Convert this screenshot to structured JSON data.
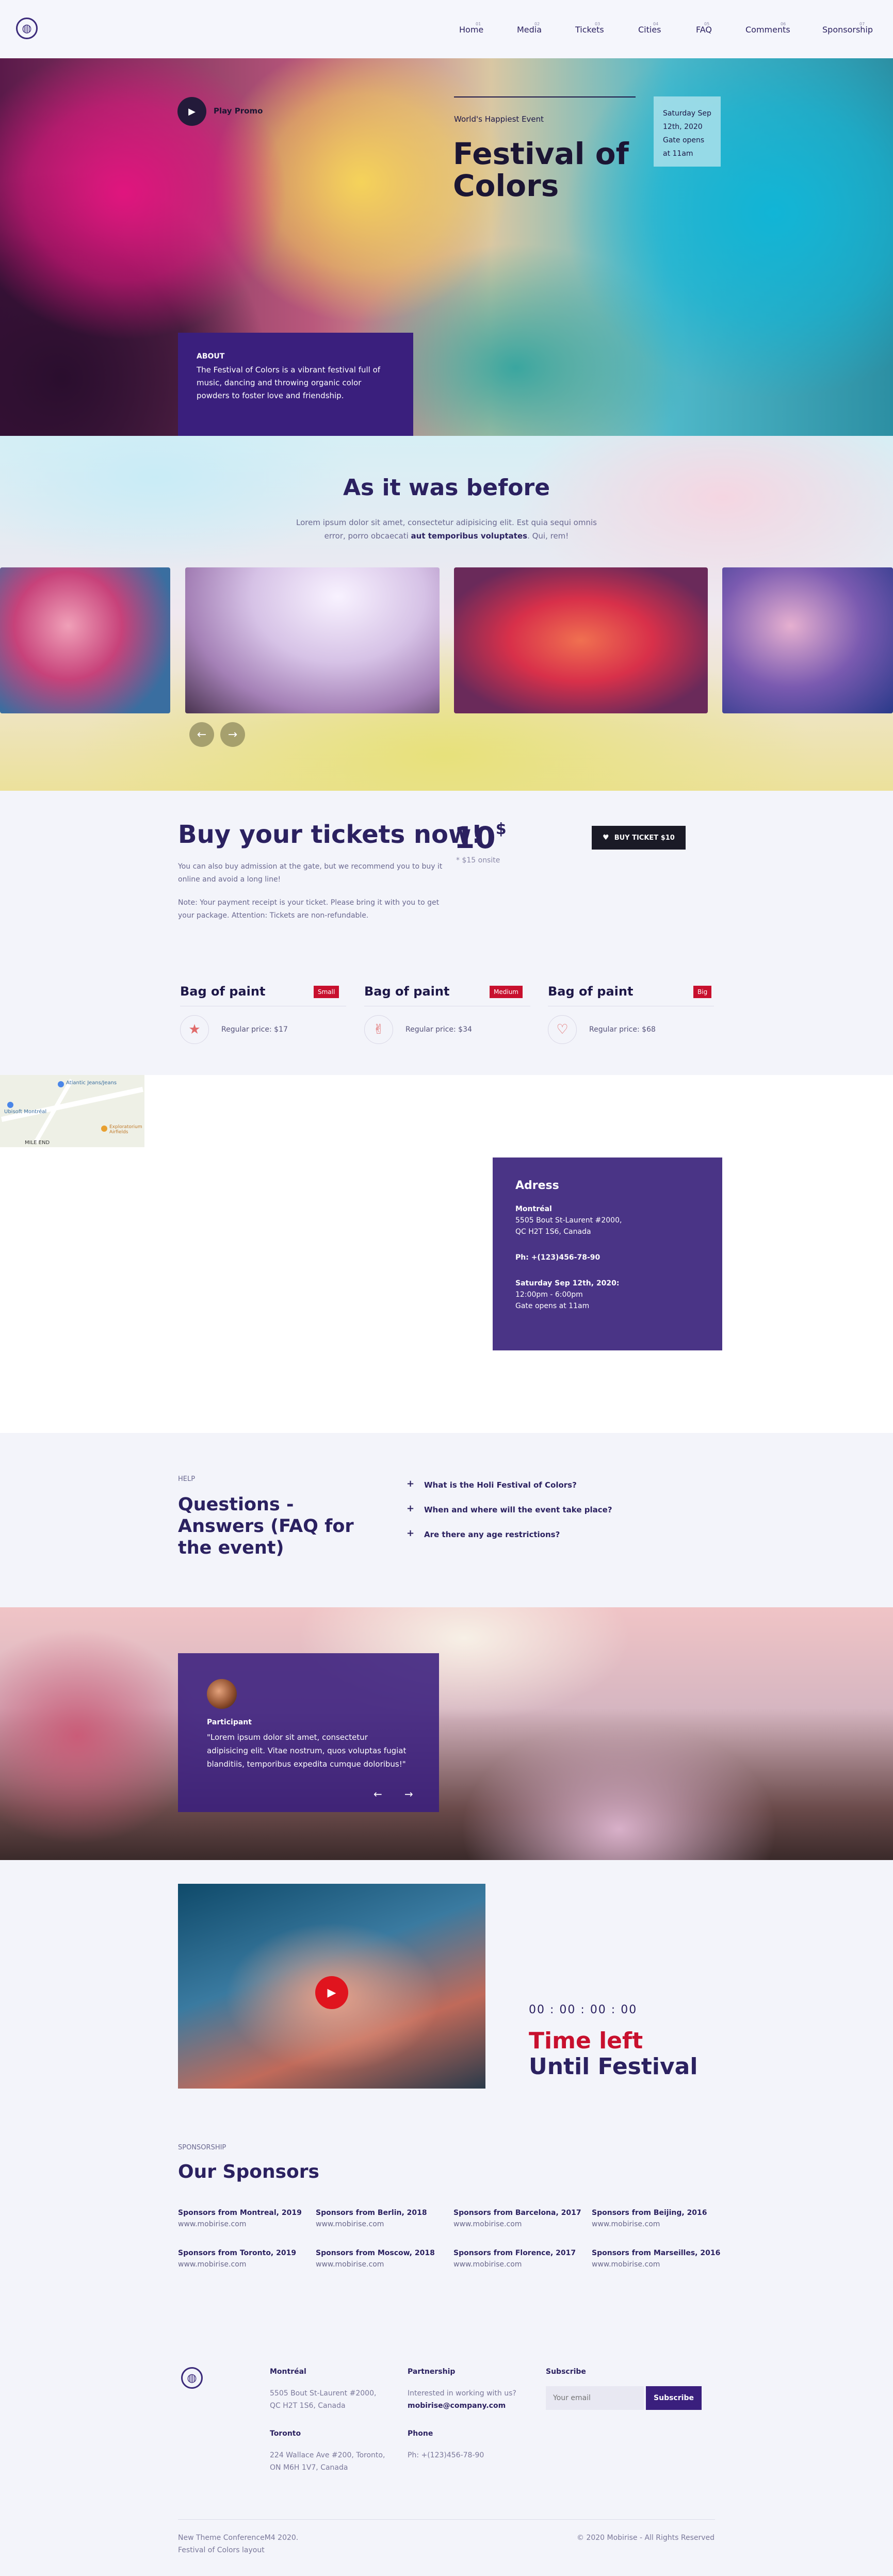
{
  "nav": {
    "items": [
      {
        "num": "01",
        "label": "Home"
      },
      {
        "num": "02",
        "label": "Media"
      },
      {
        "num": "03",
        "label": "Tickets"
      },
      {
        "num": "04",
        "label": "Cities"
      },
      {
        "num": "05",
        "label": "FAQ"
      },
      {
        "num": "06",
        "label": "Comments"
      },
      {
        "num": "07",
        "label": "Sponsorship"
      }
    ]
  },
  "hero": {
    "play_label": "Play Promo",
    "eyebrow": "World's Happiest Event",
    "title_line1": "Festival of",
    "title_line2": "Colors",
    "date": "Saturday Sep 12th, 2020 Gate opens at 11am",
    "about_heading": "ABOUT",
    "about_text": "The Festival of Colors is a vibrant festival full of music, dancing and throwing organic color powders to foster love and friendship."
  },
  "past": {
    "title": "As it was before",
    "text_plain": "Lorem ipsum dolor sit amet, consectetur adipisicing elit. Est quia sequi omnis error, porro obcaecati ",
    "text_bold": "aut temporibus voluptates",
    "text_end": ". Qui, rem!",
    "prev": "←",
    "next": "→"
  },
  "tickets": {
    "title": "Buy your tickets now!",
    "price": "10",
    "currency": "$",
    "onsite": "* $15 onsite",
    "buy_label": "BUY TICKET $10",
    "text1": "You can also buy admission at the gate, but we recommend you to buy it online and avoid a long line!",
    "text2": "Note: Your payment receipt is your ticket. Please bring it with you to get your package. Attention: Tickets are non-refundable.",
    "bags": [
      {
        "title": "Bag of paint",
        "badge": "Small",
        "price": "Regular price: $17",
        "icon": "star-icon",
        "glyph": "★"
      },
      {
        "title": "Bag of paint",
        "badge": "Medium",
        "price": "Regular price: $34",
        "icon": "victory-hand-icon",
        "glyph": "✌"
      },
      {
        "title": "Bag of paint",
        "badge": "Big",
        "price": "Regular price: $68",
        "icon": "heart-icon",
        "glyph": "♡"
      }
    ]
  },
  "map": {
    "label1": "Atlantic Jeans/Jeans",
    "label2": "Ubisoft Montréal",
    "label3": "Exploratorium Airfields",
    "district": "MILE END"
  },
  "address": {
    "title": "Adress",
    "city": "Montréal",
    "line1": "5505 Bout St-Laurent #2000,",
    "line2": "QC H2T 1S6, Canada",
    "phone": "Ph: +(123)456-78-90",
    "date": "Saturday Sep 12th, 2020:",
    "time": "12:00pm - 6:00pm",
    "gates": "Gate opens at 11am"
  },
  "faq": {
    "eyebrow": "HELP",
    "title_l1": "Questions -",
    "title_l2": "Answers (FAQ for",
    "title_l3": "the event)",
    "items": [
      "What is the Holi Festival of Colors?",
      "When and where will the event take place?",
      "Are there any age restrictions?"
    ]
  },
  "testimonial": {
    "name": "Participant",
    "quote": "\"Lorem ipsum dolor sit amet, consectetur adipisicing elit. Vitae nostrum, quos voluptas fugiat blanditiis, temporibus expedita cumque doloribus!\"",
    "prev": "←",
    "next": "→"
  },
  "countdown": {
    "days": "00",
    "hours": "00",
    "minutes": "00",
    "seconds": "00",
    "title1": "Time left",
    "title2": "Until Festival",
    "accent": "#c8102e"
  },
  "sponsors": {
    "eyebrow": "SPONSORSHIP",
    "title": "Our Sponsors",
    "items": [
      {
        "name": "Sponsors from Montreal, 2019",
        "url": "www.mobirise.com"
      },
      {
        "name": "Sponsors from Berlin, 2018",
        "url": "www.mobirise.com"
      },
      {
        "name": "Sponsors from Barcelona, 2017",
        "url": "www.mobirise.com"
      },
      {
        "name": "Sponsors from Beijing, 2016",
        "url": "www.mobirise.com"
      },
      {
        "name": "Sponsors from Toronto, 2019",
        "url": "www.mobirise.com"
      },
      {
        "name": "Sponsors from Moscow, 2018",
        "url": "www.mobirise.com"
      },
      {
        "name": "Sponsors from Florence, 2017",
        "url": "www.mobirise.com"
      },
      {
        "name": "Sponsors from Marseilles, 2016",
        "url": "www.mobirise.com"
      }
    ]
  },
  "footer": {
    "montreal_h": "Montréal",
    "montreal_t1": "5505 Bout St-Laurent #2000,",
    "montreal_t2": "QC H2T 1S6, Canada",
    "toronto_h": "Toronto",
    "toronto_t1": "224 Wallace Ave #200, Toronto,",
    "toronto_t2": "ON M6H 1V7, Canada",
    "partnership_h": "Partnership",
    "partnership_t": "Interested in working with us?",
    "partnership_email": "mobirise@company.com",
    "phone_h": "Phone",
    "phone_t": "Ph: +(123)456-78-90",
    "subscribe_h": "Subscribe",
    "email_placeholder": "Your email",
    "subscribe_btn": "Subscribe",
    "bottom_l1": "New Theme ConferenceM4 2020.",
    "bottom_l2": "Festival of Colors layout",
    "copyright": "© 2020 Mobirise - All Rights Reserved"
  }
}
